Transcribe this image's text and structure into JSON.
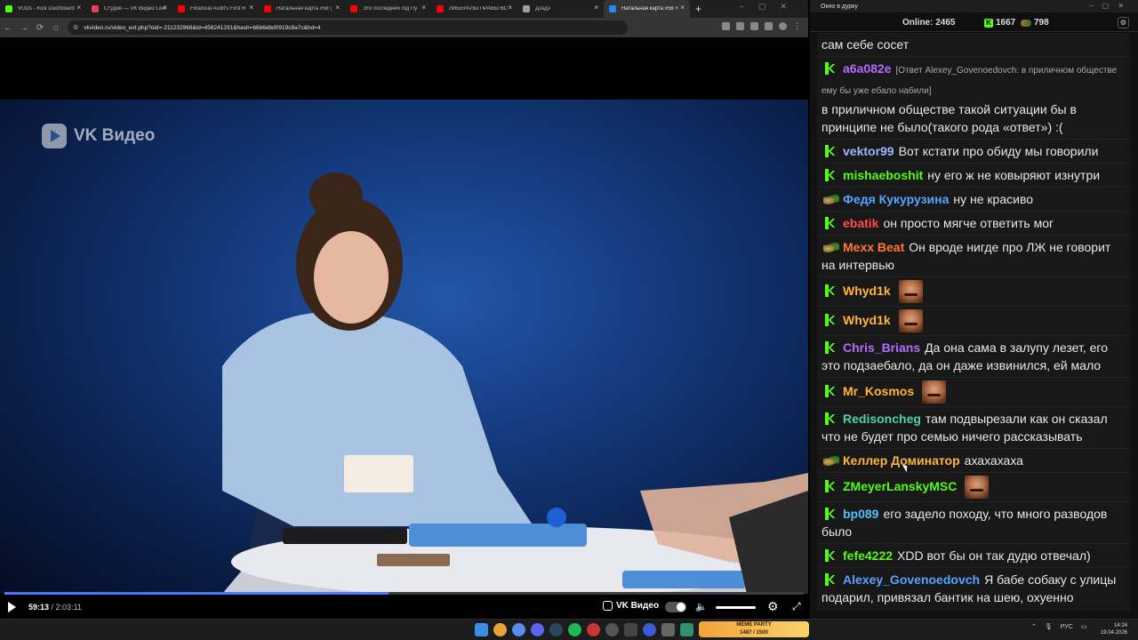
{
  "browser": {
    "tabs": [
      {
        "label": "VODs - Kick Dashboard",
        "color": "#53fc18"
      },
      {
        "label": "Студия — VK Видео Live",
        "color": "#e4405f"
      },
      {
        "label": "Financial Audit's First R",
        "color": "#ff0000"
      },
      {
        "label": "Натальная карта #58 |",
        "color": "#ff0000"
      },
      {
        "label": "Это последний год Пу",
        "color": "#ff0000"
      },
      {
        "label": "ЛИБЕРАЛЫ ПРАВЫ ВС",
        "color": "#ff0000"
      },
      {
        "label": "Дзэдэ",
        "color": "#9aa0a6"
      },
      {
        "label": "Натальная карта #58 ×",
        "color": "#2787f5",
        "active": true
      }
    ],
    "url": "vkvideo.ru/video_ext.php?oid=-211232966&id=456241291&hash=b6b6dbd0919c8a7c&hd=4"
  },
  "player": {
    "logo_text": "VK Видео",
    "time_current": "59:13",
    "time_total": "/ 2:03:11",
    "progress": 0.48,
    "brand_label": "VK Видео"
  },
  "chat": {
    "window_title": "Окно в дурку",
    "online_label": "Online:",
    "online_count": "2465",
    "kick_count": "1667",
    "other_count": "798",
    "messages": [
      {
        "user": "",
        "color": "#e8e8e8",
        "badge": "",
        "text": "сам себе сосет",
        "reply": ""
      },
      {
        "user": "a6a082e",
        "color": "#b46cff",
        "badge": "k",
        "text": "в приличном обществе такой ситуации бы в принципе не было(такого рода «ответ») :(",
        "reply": "[Ответ Alexey_Govenoedovch: в приличном обществе ему бы уже ебало набили]"
      },
      {
        "user": "vektor99",
        "color": "#9fb7ff",
        "badge": "k",
        "text": "Вот кстати про обиду мы говорили",
        "reply": ""
      },
      {
        "user": "mishaeboshit",
        "color": "#53fc18",
        "badge": "k",
        "text": "ну его ж не ковыряют изнутри",
        "reply": ""
      },
      {
        "user": "Федя Кукурузина",
        "color": "#5aa2ff",
        "badge": "g",
        "text": "ну не красиво",
        "reply": ""
      },
      {
        "user": "ebatik",
        "color": "#ff4d4d",
        "badge": "k",
        "text": "он просто мягче ответить мог",
        "reply": ""
      },
      {
        "user": "Mexx Beat",
        "color": "#ff7a2e",
        "badge": "g",
        "text": "Он вроде нигде про ЛЖ не говорит на интервью",
        "reply": ""
      },
      {
        "user": "Whyd1k",
        "color": "#ffb43a",
        "badge": "k",
        "text": "",
        "reply": "",
        "emote": true
      },
      {
        "user": "Whyd1k",
        "color": "#ffb43a",
        "badge": "k",
        "text": "",
        "reply": "",
        "emote": true
      },
      {
        "user": "Chris_Brians",
        "color": "#b46cff",
        "badge": "k",
        "text": "Да она сама в залупу лезет, его это подзаебало, да он даже извинился, ей мало",
        "reply": ""
      },
      {
        "user": "Mr_Kosmos",
        "color": "#ffb43a",
        "badge": "k",
        "text": "",
        "reply": "",
        "emote": true
      },
      {
        "user": "Redisoncheg",
        "color": "#4fd3a3",
        "badge": "k",
        "text": "там подвырезали как он сказал что не будет про семью ничего рассказывать",
        "reply": ""
      },
      {
        "user": "Келлер Доминатор",
        "color": "#ffb43a",
        "badge": "g",
        "text": "ахахахаха",
        "reply": ""
      },
      {
        "user": "ZMeyerLanskyMSC",
        "color": "#53fc18",
        "badge": "k",
        "text": "",
        "reply": "",
        "emote": true
      },
      {
        "user": "bp089",
        "color": "#53c1ff",
        "badge": "k",
        "text": "его задело походу, что много разводов было",
        "reply": ""
      },
      {
        "user": "fefe4222",
        "color": "#53fc18",
        "badge": "k",
        "text": "XDD вот бы он так дудю отвечал)",
        "reply": ""
      },
      {
        "user": "Alexey_Govenoedovch",
        "color": "#5aa2ff",
        "badge": "k",
        "text": "Я бабе собаку с улицы подарил, привязал бантик на шею, охуенно получилось",
        "reply": ""
      }
    ]
  },
  "taskbar": {
    "meme_title": "MEME PARTY",
    "meme_progress": "1487 / 1500",
    "lang": "РУС",
    "time": "14:24",
    "date": "19.04.2026"
  }
}
